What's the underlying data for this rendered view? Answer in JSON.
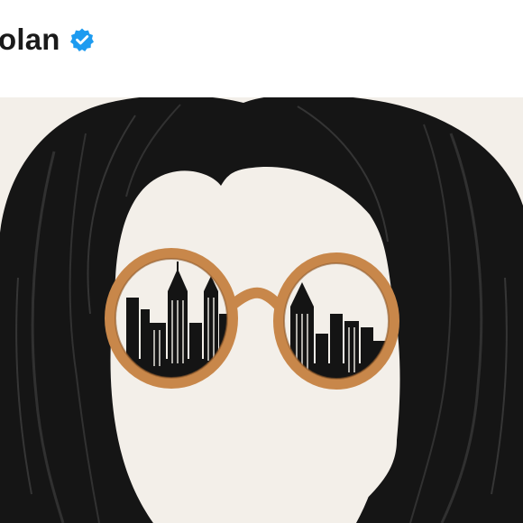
{
  "profile": {
    "username": "olan",
    "verified_badge_icon": "verified-badge-icon",
    "badge_color": "#1d9bf0"
  },
  "post": {
    "image_icon": "illustration-hair-glasses-city-skyline",
    "colors": {
      "background": "#f3efe9",
      "hair": "#151515",
      "glasses_frame": "#c8874a",
      "skyline": "#141414"
    }
  }
}
